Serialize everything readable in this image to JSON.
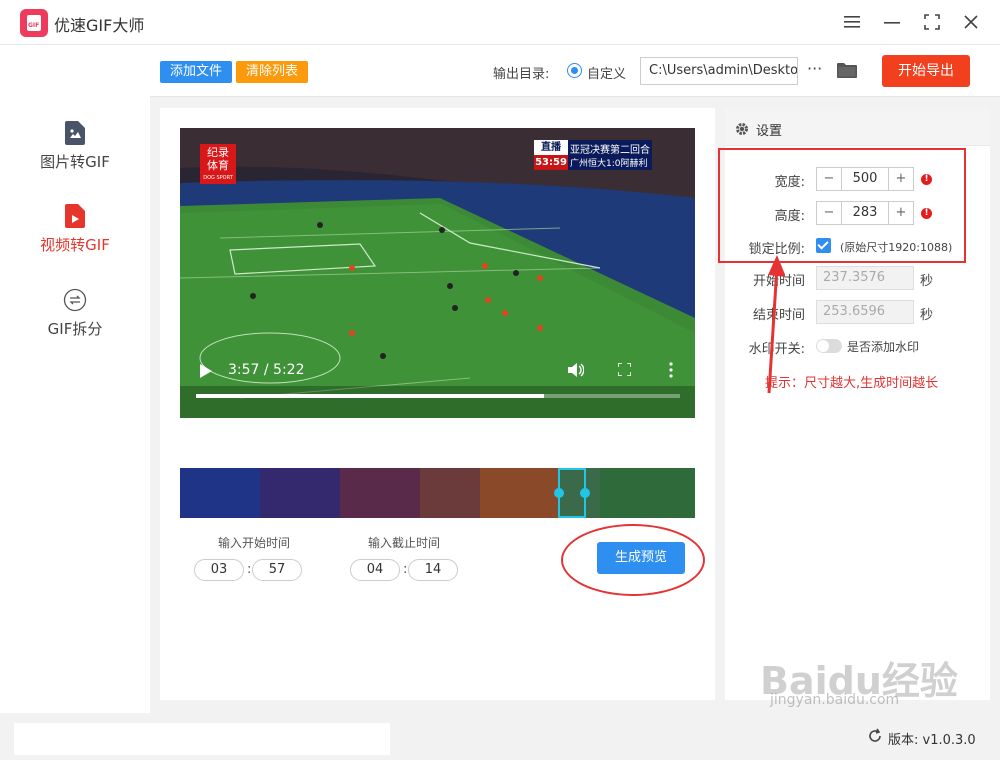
{
  "app": {
    "title": "优速GIF大师",
    "logo_text": "GIF"
  },
  "window": {
    "menu_icon": "menu-icon",
    "minimize_icon": "minimize-icon",
    "maximize_icon": "maximize-icon",
    "close_icon": "close-icon"
  },
  "sidebar": {
    "items": [
      {
        "label": "图片转GIF",
        "icon": "image-file-icon",
        "active": false
      },
      {
        "label": "视频转GIF",
        "icon": "video-file-icon",
        "active": true
      },
      {
        "label": "GIF拆分",
        "icon": "split-icon",
        "active": false
      }
    ]
  },
  "toolbar": {
    "add_file": "添加文件",
    "clear_list": "清除列表",
    "output_dir_label": "输出目录:",
    "custom_label": "自定义",
    "path": "C:\\Users\\admin\\Deskto",
    "more": "···",
    "start_export": "开始导出"
  },
  "video": {
    "overlay_left_line1": "纪录",
    "overlay_left_line2": "体育",
    "overlay_left_line3": "DOG SPORT",
    "live_label": "直播",
    "live_time": "53:59",
    "match_title": "亚冠决赛第二回合",
    "match_score": "广州恒大1:0阿赫利",
    "time_display": "3:57 / 5:22",
    "progress": 0.72
  },
  "trim": {
    "start_label": "输入开始时间",
    "end_label": "输入截止时间",
    "start_min": "03",
    "start_sec": "57",
    "end_min": "04",
    "end_sec": "14",
    "separator": ":",
    "preview_button": "生成预览"
  },
  "settings": {
    "title": "设置",
    "width_label": "宽度:",
    "width_value": "500",
    "height_label": "高度:",
    "height_value": "283",
    "lock_label": "锁定比例:",
    "original_size": "(原始尺寸1920:1088)",
    "start_time_label": "开始时间",
    "start_time_value": "237.3576",
    "end_time_label": "结束时间",
    "end_time_value": "253.6596",
    "sec_unit": "秒",
    "watermark_label": "水印开关:",
    "watermark_text": "是否添加水印",
    "minus": "−",
    "plus": "+",
    "warn": "!"
  },
  "annotation": {
    "tip": "提示：尺寸越大,生成时间越长"
  },
  "footer": {
    "version_label": "版本:",
    "version": "v1.0.3.0"
  },
  "watermark": {
    "brand": "Baidu经验",
    "url": "jingyan.baidu.com"
  },
  "colors": {
    "primary": "#2e8ff0",
    "orange": "#fb9a0c",
    "danger": "#f2401f",
    "annotation_red": "#e53333"
  }
}
